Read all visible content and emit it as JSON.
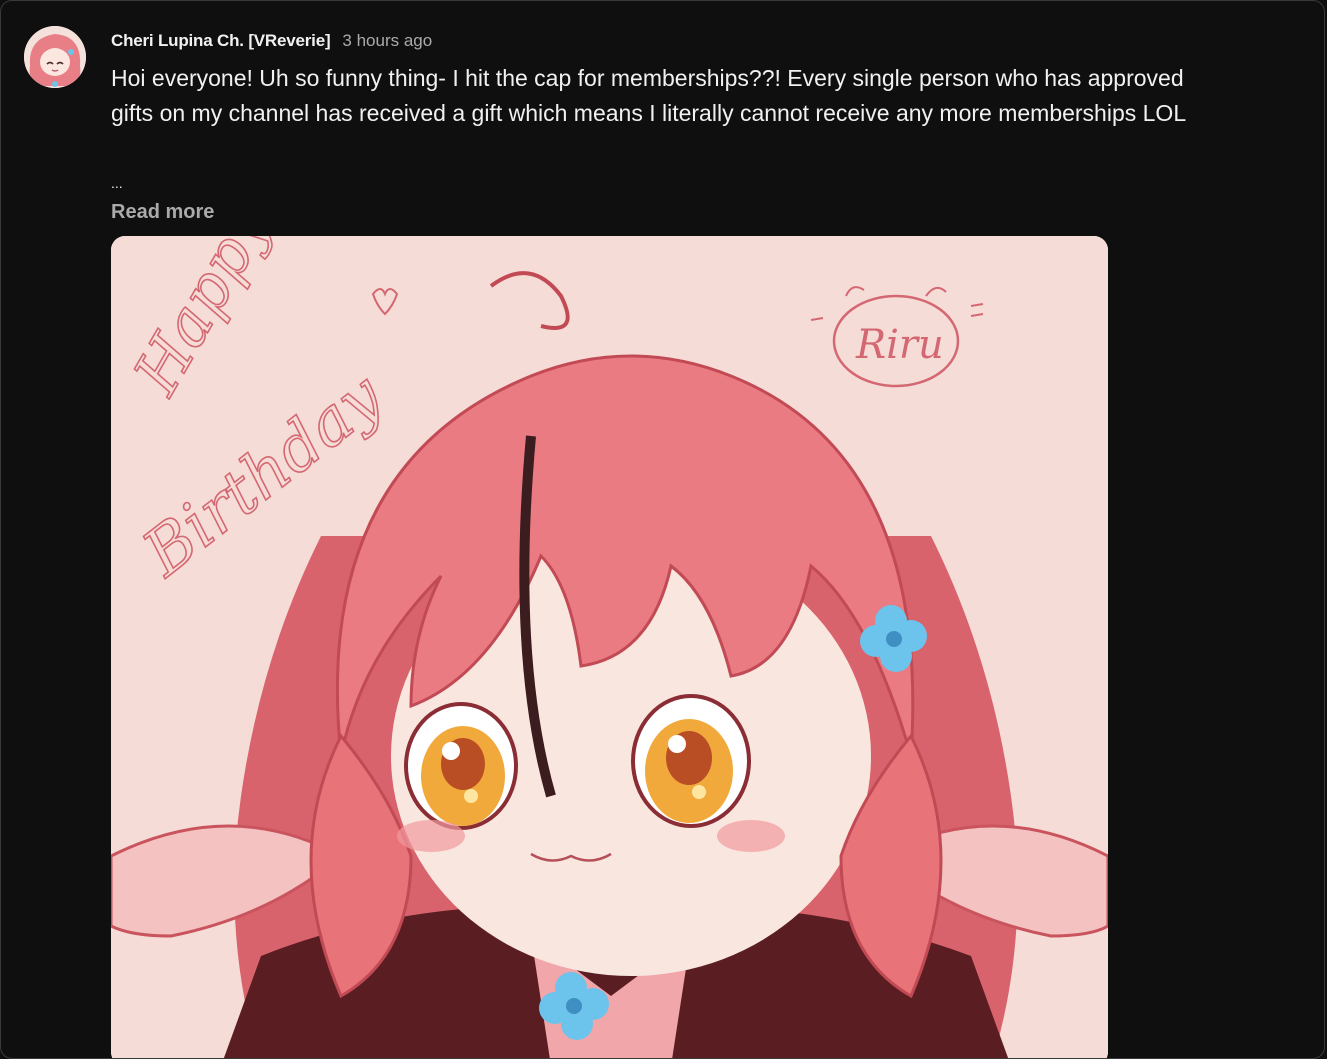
{
  "post": {
    "author": "Cheri Lupina Ch. [VReverie]",
    "time": "3 hours ago",
    "text": "Hoi everyone! Uh so funny thing- I hit the cap for memberships??! Every single person who has approved gifts on my channel has received a gift which means I literally cannot receive any more memberships LOL",
    "ellipsis": "...",
    "read_more": "Read more"
  },
  "image": {
    "handwriting_top": "Happy",
    "handwriting_bottom": "Birthday",
    "signature": "Riru",
    "background_color": "#f6dcd6",
    "hair_color": "#e8747a",
    "eye_color": "#f2a93b",
    "flower_color": "#6cc3ec"
  }
}
